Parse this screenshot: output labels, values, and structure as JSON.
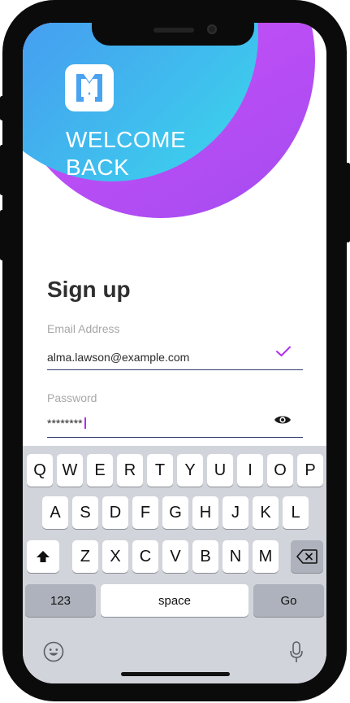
{
  "header": {
    "welcome_line1": "WELCOME",
    "welcome_line2": "BACK",
    "logo_icon": "brand-logo-icon"
  },
  "form": {
    "title": "Sign up",
    "email": {
      "label": "Email Address",
      "value": "alma.lawson@example.com",
      "status_icon": "check-icon"
    },
    "password": {
      "label": "Password",
      "value": "********",
      "toggle_icon": "eye-icon"
    }
  },
  "keyboard": {
    "row1": [
      "Q",
      "W",
      "E",
      "R",
      "T",
      "Y",
      "U",
      "I",
      "O",
      "P"
    ],
    "row2": [
      "A",
      "S",
      "D",
      "F",
      "G",
      "H",
      "J",
      "K",
      "L"
    ],
    "row3": [
      "Z",
      "X",
      "C",
      "V",
      "B",
      "N",
      "M"
    ],
    "numbers_label": "123",
    "space_label": "space",
    "go_label": "Go",
    "shift_icon": "shift-icon",
    "delete_icon": "delete-icon",
    "emoji_icon": "emoji-icon",
    "mic_icon": "microphone-icon"
  },
  "colors": {
    "accent": "#b32cf0",
    "underline": "#2f3a6b",
    "gradient_blue": "#4c8ef5",
    "gradient_cyan": "#3ad8ec",
    "gradient_purple": "#c04ef6"
  }
}
